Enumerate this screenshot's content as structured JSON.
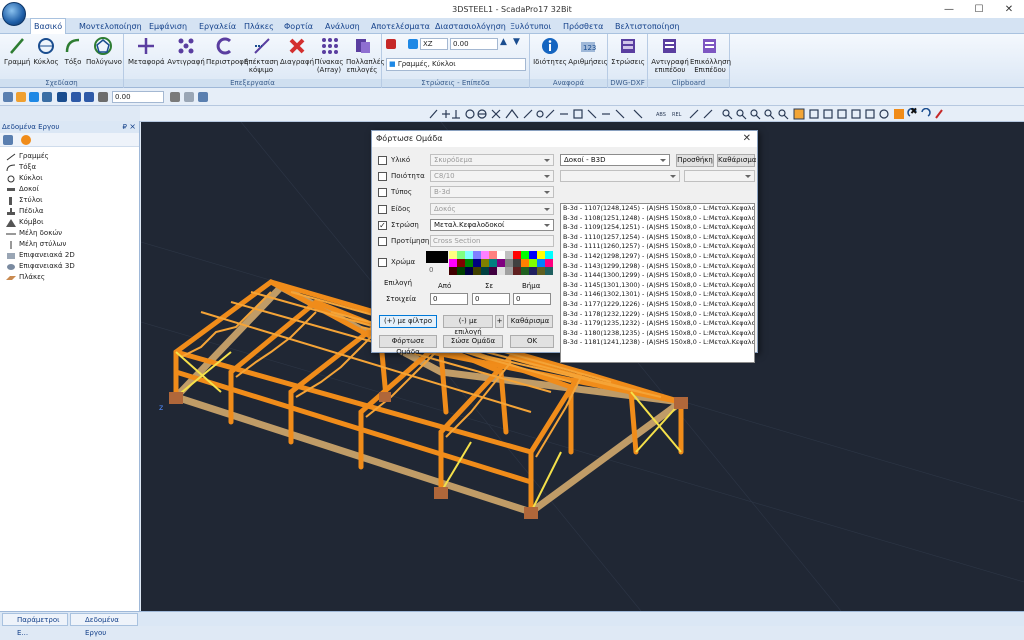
{
  "window": {
    "title": "3DSTEEL1 - ScadaPro17 32Bit"
  },
  "tabs": [
    {
      "label": "Βασικό",
      "active": true
    },
    {
      "label": "Μοντελοποίηση"
    },
    {
      "label": "Εμφάνιση"
    },
    {
      "label": "Εργαλεία"
    },
    {
      "label": "Πλάκες"
    },
    {
      "label": "Φορτία"
    },
    {
      "label": "Ανάλυση"
    },
    {
      "label": "Αποτελέσματα"
    },
    {
      "label": "Διαστασιολόγηση"
    },
    {
      "label": "Ξυλότυποι"
    },
    {
      "label": "Πρόσθετα"
    },
    {
      "label": "Βελτιστοποίηση"
    }
  ],
  "ribbon": {
    "groups": [
      {
        "label": "Σχεδίαση",
        "buttons": [
          "Γραμμή",
          "Κύκλος",
          "Τόξο",
          "Πολύγωνο"
        ]
      },
      {
        "label": "Επεξεργασία",
        "buttons": [
          "Μεταφορά",
          "Αντιγραφή",
          "Περιστροφή",
          "Επέκταση κόψιμο",
          "Διαγραφή",
          "Πίνακας (Array)",
          "Πολλαπλές επιλογές"
        ]
      },
      {
        "label": "Στρώσεις - Επίπεδα",
        "plane": "XZ",
        "level": "0.00",
        "layer": "Γραμμές, Κύκλοι"
      },
      {
        "label": "Αναφορά",
        "buttons": [
          "Ιδιότητες",
          "Αριθμήσεις"
        ]
      },
      {
        "label": "DWG-DXF",
        "buttons": [
          "Στρώσεις"
        ]
      },
      {
        "label": "Clipboard",
        "buttons": [
          "Αντιγραφή επιπέδου",
          "Επικόλληση Επιπέδου"
        ]
      }
    ]
  },
  "toolbar2": {
    "value": "0.00"
  },
  "left_panel": {
    "title": "Δεδομένα Εργου",
    "pin": "₽",
    "close": "×",
    "tree": [
      "Γραμμές",
      "Τόξα",
      "Κύκλοι",
      "Δοκοί",
      "Στύλοι",
      "Πέδιλα",
      "Κόμβοι",
      "Μέλη δοκών",
      "Μέλη στύλων",
      "Επιφανειακά 2D",
      "Επιφανειακά 3D",
      "Πλάκες"
    ]
  },
  "bottom_tabs": [
    "Παράμετροι Ε...",
    "Δεδομένα Εργου"
  ],
  "dialog": {
    "title": "Φόρτωσε Ομάδα",
    "close": "✕",
    "rows": [
      {
        "label": "Υλικό",
        "checked": false,
        "value": "Σκυρόδεμα",
        "enabled": false
      },
      {
        "label": "Ποιότητα",
        "checked": false,
        "value": "C8/10",
        "enabled": false
      },
      {
        "label": "Τύπος",
        "checked": false,
        "value": "B-3d",
        "enabled": false
      },
      {
        "label": "Είδος",
        "checked": false,
        "value": "Δοκός",
        "enabled": false
      },
      {
        "label": "Στρώση",
        "checked": true,
        "value": "Μεταλ.Κεφαλοδοκοί",
        "enabled": true
      },
      {
        "label": "Προτίμηση",
        "checked": false,
        "value": "Cross Section",
        "enabled": false
      }
    ],
    "color_label": "Χρώμα",
    "color_index": "0",
    "selection_label": "Επιλογή",
    "from_label": "Από",
    "to_label": "Σε",
    "step_label": "Βήμα",
    "elements_label": "Στοιχεία",
    "from_value": "0",
    "to_value": "0",
    "step_value": "0",
    "btn_filter_plus": "(+) με φίλτρο",
    "btn_select_minus": "(-) με επιλογή",
    "btn_plus": "+",
    "btn_clear": "Καθάρισμα",
    "btn_load": "Φόρτωσε Ομάδα",
    "btn_save": "Σώσε Ομάδα",
    "btn_ok": "OK",
    "right_combo": "Δοκοί - B3D",
    "btn_add": "Προσθήκη",
    "btn_clear2": "Καθάρισμα",
    "list": [
      "B-3d - 1107(1248,1245) - (A)SHS 150x8,0 - L:Μεταλ.Κεφαλοδοκ",
      "B-3d - 1108(1251,1248) - (A)SHS 150x8,0 - L:Μεταλ.Κεφαλοδοκ",
      "B-3d - 1109(1254,1251) - (A)SHS 150x8,0 - L:Μεταλ.Κεφαλοδοκ",
      "B-3d - 1110(1257,1254) - (A)SHS 150x8,0 - L:Μεταλ.Κεφαλοδοκ",
      "B-3d - 1111(1260,1257) - (A)SHS 150x8,0 - L:Μεταλ.Κεφαλοδοκ",
      "B-3d - 1142(1298,1297) - (A)SHS 150x8,0 - L:Μεταλ.Κεφαλοδοκ",
      "B-3d - 1143(1299,1298) - (A)SHS 150x8,0 - L:Μεταλ.Κεφαλοδοκ",
      "B-3d - 1144(1300,1299) - (A)SHS 150x8,0 - L:Μεταλ.Κεφαλοδοκ",
      "B-3d - 1145(1301,1300) - (A)SHS 150x8,0 - L:Μεταλ.Κεφαλοδοκ",
      "B-3d - 1146(1302,1301) - (A)SHS 150x8,0 - L:Μεταλ.Κεφαλοδοκ",
      "B-3d - 1177(1229,1226) - (A)SHS 150x8,0 - L:Μεταλ.Κεφαλοδοκ",
      "B-3d - 1178(1232,1229) - (A)SHS 150x8,0 - L:Μεταλ.Κεφαλοδοκ",
      "B-3d - 1179(1235,1232) - (A)SHS 150x8,0 - L:Μεταλ.Κεφαλοδοκ",
      "B-3d - 1180(1238,1235) - (A)SHS 150x8,0 - L:Μεταλ.Κεφαλοδοκ",
      "B-3d - 1181(1241,1238) - (A)SHS 150x8,0 - L:Μεταλ.Κεφαλοδοκ"
    ]
  },
  "colors": {
    "accent": "#15428b",
    "steel": "#f08c1a",
    "concrete": "#c9a36a",
    "viewport_bg": "#202734"
  },
  "icons": [
    "line-icon",
    "circle-icon",
    "arc-icon",
    "polygon-icon",
    "move-icon",
    "copy-icon",
    "rotate-icon",
    "extend-icon",
    "delete-icon",
    "array-icon",
    "multi-select-icon",
    "properties-icon",
    "numbering-icon",
    "layers-icon",
    "copy-level-icon",
    "paste-level-icon"
  ]
}
